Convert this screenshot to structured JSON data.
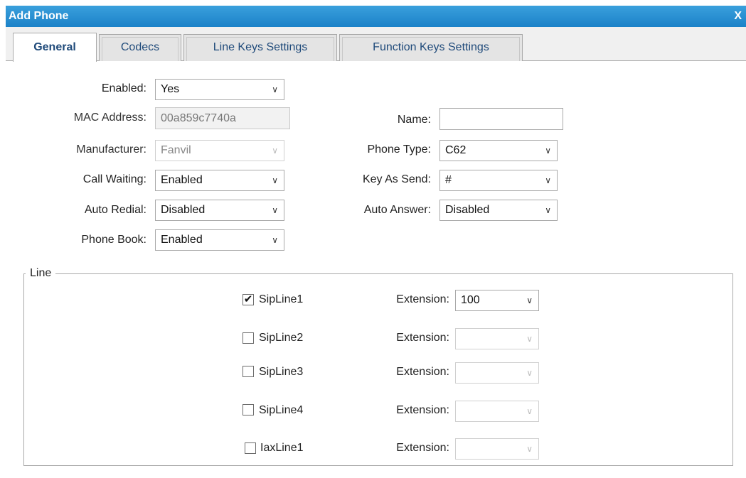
{
  "dialog": {
    "title": "Add Phone",
    "close_label": "X"
  },
  "tabs": [
    {
      "label": "General"
    },
    {
      "label": "Codecs"
    },
    {
      "label": "Line Keys Settings"
    },
    {
      "label": "Function Keys Settings"
    }
  ],
  "form": {
    "enabled": {
      "label": "Enabled:",
      "value": "Yes"
    },
    "mac_address": {
      "label": "MAC Address:",
      "value": "00a859c7740a"
    },
    "name": {
      "label": "Name:",
      "value": ""
    },
    "manufacturer": {
      "label": "Manufacturer:",
      "value": "Fanvil"
    },
    "phone_type": {
      "label": "Phone Type:",
      "value": "C62"
    },
    "call_waiting": {
      "label": "Call Waiting:",
      "value": "Enabled"
    },
    "key_as_send": {
      "label": "Key As Send:",
      "value": "#"
    },
    "auto_redial": {
      "label": "Auto Redial:",
      "value": "Disabled"
    },
    "auto_answer": {
      "label": "Auto Answer:",
      "value": "Disabled"
    },
    "phone_book": {
      "label": "Phone Book:",
      "value": "Enabled"
    }
  },
  "line_section": {
    "legend": "Line",
    "extension_label": "Extension:",
    "lines": [
      {
        "label": "SipLine1",
        "checked": true,
        "extension": "100"
      },
      {
        "label": "SipLine2",
        "checked": false,
        "extension": ""
      },
      {
        "label": "SipLine3",
        "checked": false,
        "extension": ""
      },
      {
        "label": "SipLine4",
        "checked": false,
        "extension": ""
      },
      {
        "label": "IaxLine1",
        "checked": false,
        "extension": ""
      }
    ],
    "check_glyph": "✔"
  },
  "icons": {
    "dropdown": "chevron-down-icon",
    "arrow_glyph": "∨"
  }
}
